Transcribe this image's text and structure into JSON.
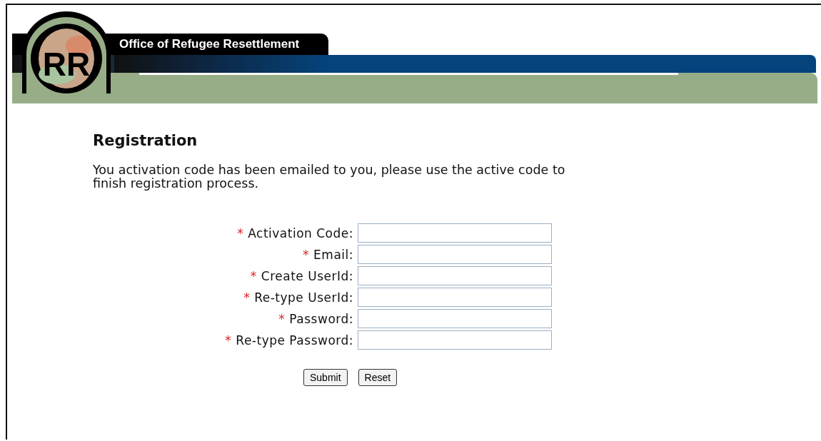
{
  "header": {
    "logo_letters": "RR",
    "title": "Office of Refugee Resettlement"
  },
  "heading": "Registration",
  "message": "You activation code has been emailed to you, please use the active code to finish registration process.",
  "fields": [
    {
      "label": "Activation Code:",
      "required": true
    },
    {
      "label": "Email:",
      "required": true
    },
    {
      "label": "Create UserId:",
      "required": true
    },
    {
      "label": "Re-type UserId:",
      "required": true
    },
    {
      "label": "Password:",
      "required": true
    },
    {
      "label": "Re-type Password:",
      "required": true
    }
  ],
  "required_mark": "*",
  "buttons": [
    "Submit",
    "Reset"
  ]
}
